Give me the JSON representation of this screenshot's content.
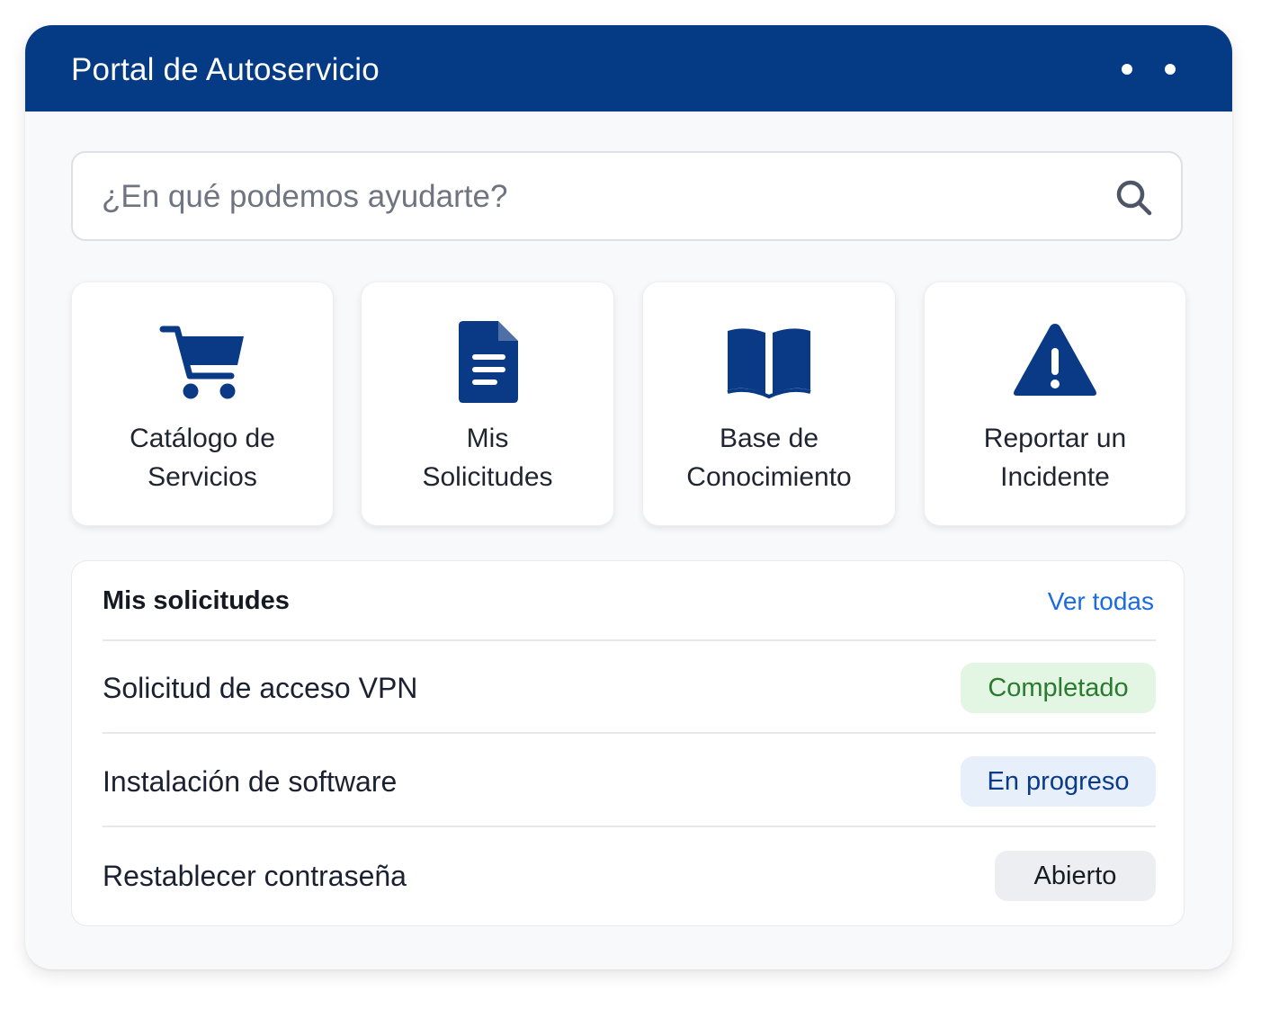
{
  "header": {
    "title": "Portal de Autoservicio",
    "menu_icon": "more-dots-icon",
    "color": "#053a84"
  },
  "search": {
    "placeholder": "¿En qué podemos ayudarte?",
    "value": "",
    "icon": "search-icon"
  },
  "tiles": [
    {
      "label": "Catálogo de\nServicios",
      "icon": "shopping-cart-icon"
    },
    {
      "label": "Mis\nSolicitudes",
      "icon": "document-icon"
    },
    {
      "label": "Base de\nConocimiento",
      "icon": "open-book-icon"
    },
    {
      "label": "Reportar un\nIncidente",
      "icon": "warning-triangle-icon"
    }
  ],
  "requests": {
    "title": "Mis solicitudes",
    "view_all": "Ver todas",
    "rows": [
      {
        "label": "Solicitud de acceso VPN",
        "status": "Completado",
        "status_bg": "#e3f5e3",
        "status_fg": "#2a7a2f"
      },
      {
        "label": "Instalación de software",
        "status": "En progreso",
        "status_bg": "#e7effb",
        "status_fg": "#0a3b8a"
      },
      {
        "label": "Restablecer contraseña",
        "status": "Abierto",
        "status_bg": "#eceef1",
        "status_fg": "#161b24"
      }
    ]
  },
  "colors": {
    "accent": "#053a84",
    "link": "#1a6be0",
    "icon": "#0a3a86"
  }
}
